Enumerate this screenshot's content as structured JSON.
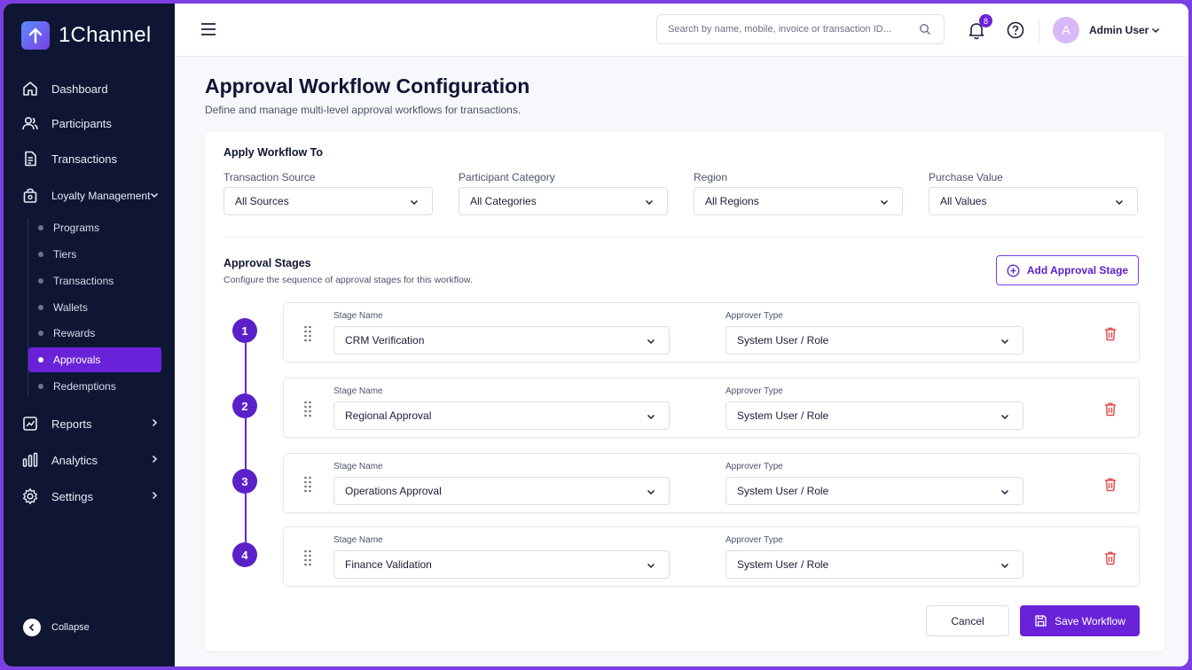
{
  "brand": {
    "name": "1Channel"
  },
  "sidebar": {
    "items": [
      {
        "label": "Dashboard"
      },
      {
        "label": "Participants"
      },
      {
        "label": "Transactions"
      },
      {
        "label": "Loyalty Management"
      },
      {
        "label": "Reports"
      },
      {
        "label": "Analytics"
      },
      {
        "label": "Settings"
      }
    ],
    "sub_items": [
      {
        "label": "Programs"
      },
      {
        "label": "Tiers"
      },
      {
        "label": "Transactions"
      },
      {
        "label": "Wallets"
      },
      {
        "label": "Rewards"
      },
      {
        "label": "Approvals",
        "active": true
      },
      {
        "label": "Redemptions"
      }
    ],
    "collapse_label": "Collapse"
  },
  "topbar": {
    "search_placeholder": "Search by name, mobile, invoice or transaction ID...",
    "notification_count": "8",
    "avatar_initial": "A",
    "user_name": "Admin User"
  },
  "page": {
    "title": "Approval Workflow Configuration",
    "subtitle": "Define and manage multi-level approval workflows for transactions."
  },
  "apply_to": {
    "heading": "Apply Workflow To",
    "filters": [
      {
        "label": "Transaction Source",
        "value": "All Sources"
      },
      {
        "label": "Participant Category",
        "value": "All Categories"
      },
      {
        "label": "Region",
        "value": "All Regions"
      },
      {
        "label": "Purchase Value",
        "value": "All Values"
      }
    ]
  },
  "stages": {
    "heading": "Approval Stages",
    "subheading": "Configure the sequence of approval stages for this workflow.",
    "add_button": "Add Approval Stage",
    "stage_name_label": "Stage Name",
    "approver_type_label": "Approver Type",
    "items": [
      {
        "number": "1",
        "name": "CRM Verification",
        "approver": "System User / Role"
      },
      {
        "number": "2",
        "name": "Regional Approval",
        "approver": "System User / Role"
      },
      {
        "number": "3",
        "name": "Operations Approval",
        "approver": "System User / Role"
      },
      {
        "number": "4",
        "name": "Finance Validation",
        "approver": "System User / Role"
      }
    ]
  },
  "actions": {
    "cancel": "Cancel",
    "save": "Save Workflow"
  },
  "colors": {
    "accent": "#6a22d9",
    "sidebar_bg": "#0f1633",
    "danger": "#e5484d"
  }
}
